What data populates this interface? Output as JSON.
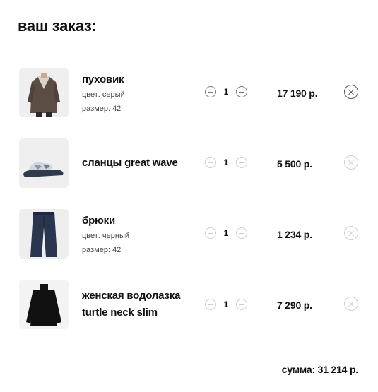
{
  "title": "ваш заказ:",
  "items": [
    {
      "name": "пуховик",
      "color_label": "цвет: серый",
      "size_label": "размер: 42",
      "qty": "1",
      "price": "17 190 р."
    },
    {
      "name": "сланцы great wave",
      "qty": "1",
      "price": "5 500 р."
    },
    {
      "name": "брюки",
      "color_label": "цвет: черный",
      "size_label": "размер: 42",
      "qty": "1",
      "price": "1 234 р."
    },
    {
      "name_line1": "женская водолазка",
      "name_line2": "turtle neck slim",
      "qty": "1",
      "price": "7 290 р."
    }
  ],
  "total": "сумма: 31 214 р.",
  "icons": {
    "minus": "minus-circle-icon",
    "plus": "plus-circle-icon",
    "remove": "close-circle-icon"
  }
}
